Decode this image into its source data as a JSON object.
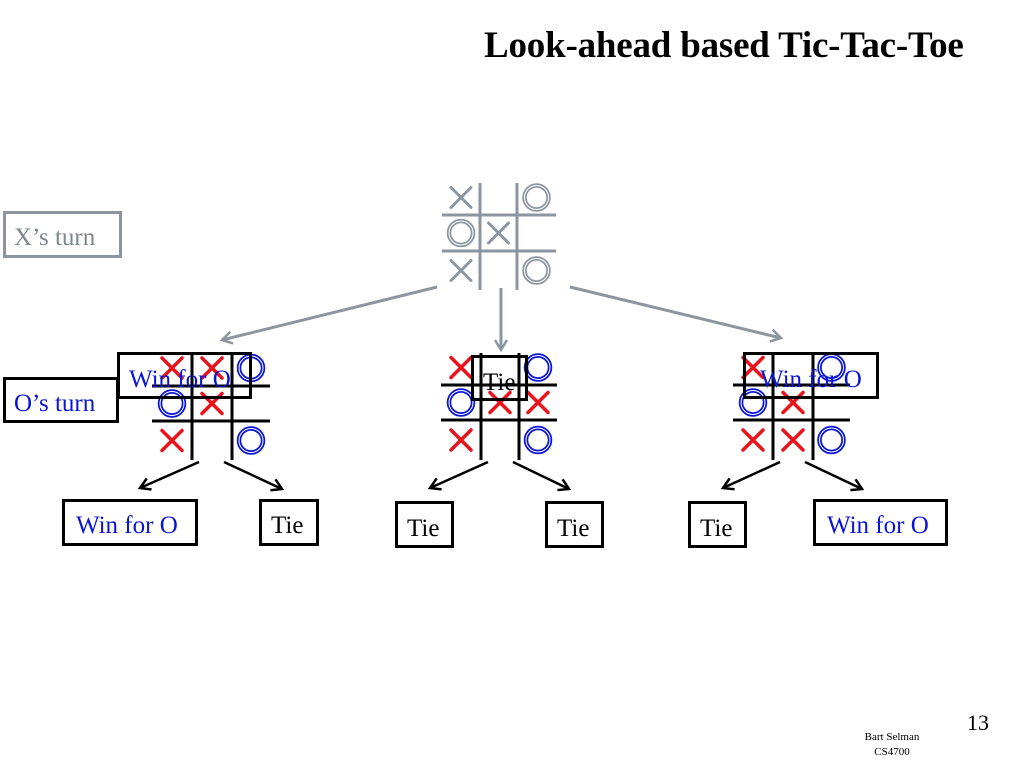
{
  "slide": {
    "title": "Look-ahead based Tic-Tac-Toe",
    "page_number": "13",
    "footer_author": "Bart Selman",
    "footer_course": "CS4700"
  },
  "labels": {
    "x_turn": "X’s turn",
    "o_turn": "O’s turn"
  },
  "colors": {
    "root_gray": "#8d96a0",
    "x_red": "#e8131b",
    "o_blue": "#0a14d6",
    "grid_black": "#000000"
  },
  "boards": {
    "root": {
      "cells": [
        "X",
        "",
        "O",
        "O",
        "X",
        "",
        "X",
        "",
        "O"
      ],
      "style": "gray"
    },
    "children": [
      {
        "cells": [
          "X",
          "X",
          "O",
          "O",
          "X",
          "",
          "X",
          "",
          "O"
        ],
        "overlay_label": "Win for O",
        "overlay_color": "blue"
      },
      {
        "cells": [
          "X",
          "",
          "O",
          "O",
          "X",
          "X",
          "X",
          "",
          "O"
        ],
        "overlay_label": "Tie",
        "overlay_color": "black"
      },
      {
        "cells": [
          "X",
          "",
          "O",
          "O",
          "X",
          "",
          "X",
          "X",
          "O"
        ],
        "overlay_label": "Win for O",
        "overlay_color": "blue"
      }
    ]
  },
  "outcomes": [
    {
      "label": "Win for O",
      "color": "blue"
    },
    {
      "label": "Tie",
      "color": "black"
    },
    {
      "label": "Tie",
      "color": "black"
    },
    {
      "label": "Tie",
      "color": "black"
    },
    {
      "label": "Tie",
      "color": "black"
    },
    {
      "label": "Win for O",
      "color": "blue"
    }
  ]
}
